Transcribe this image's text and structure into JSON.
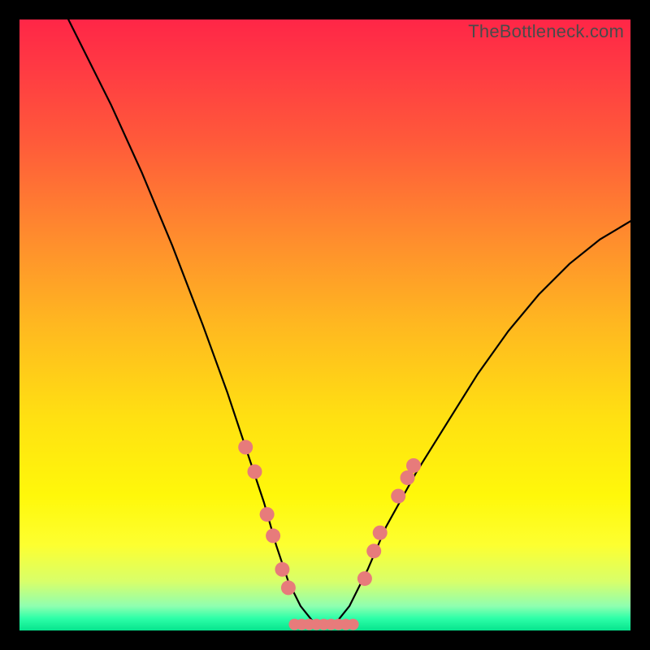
{
  "watermark": "TheBottleneck.com",
  "chart_data": {
    "type": "line",
    "title": "",
    "xlabel": "",
    "ylabel": "",
    "xlim": [
      0,
      100
    ],
    "ylim": [
      0,
      100
    ],
    "series": [
      {
        "name": "bottleneck-curve",
        "x": [
          8,
          15,
          20,
          25,
          30,
          34,
          37,
          40,
          42,
          44,
          46,
          48,
          50,
          52,
          54,
          57,
          60,
          65,
          70,
          75,
          80,
          85,
          90,
          95,
          100
        ],
        "y": [
          100,
          86,
          75,
          63,
          50,
          39,
          30,
          21,
          14,
          8,
          4,
          1.5,
          0.8,
          1.5,
          4,
          10,
          17,
          26,
          34,
          42,
          49,
          55,
          60,
          64,
          67
        ]
      }
    ],
    "markers": {
      "name": "highlight-dots",
      "color": "#e77b7b",
      "points": [
        {
          "x": 37.0,
          "y": 30
        },
        {
          "x": 38.5,
          "y": 26
        },
        {
          "x": 40.5,
          "y": 19
        },
        {
          "x": 41.5,
          "y": 15.5
        },
        {
          "x": 43.0,
          "y": 10
        },
        {
          "x": 44.0,
          "y": 7
        },
        {
          "x": 56.5,
          "y": 8.5
        },
        {
          "x": 58.0,
          "y": 13
        },
        {
          "x": 59.0,
          "y": 16
        },
        {
          "x": 62.0,
          "y": 22
        },
        {
          "x": 63.5,
          "y": 25
        },
        {
          "x": 64.5,
          "y": 27
        }
      ],
      "flat_segment": {
        "x_start": 45,
        "x_end": 55,
        "y": 1.0
      }
    }
  }
}
